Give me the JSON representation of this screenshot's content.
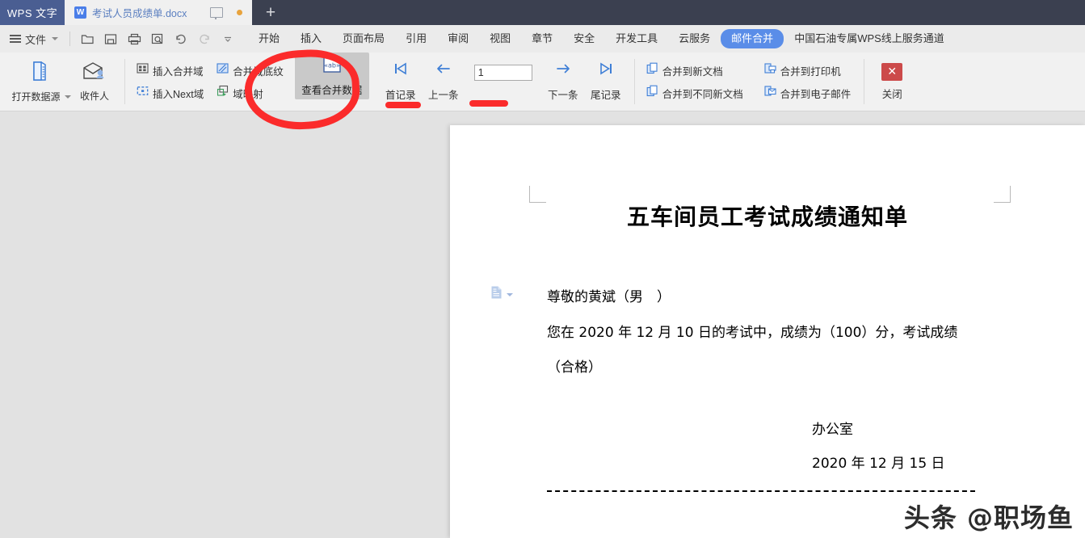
{
  "titlebar": {
    "app_name": "WPS 文字",
    "tab": {
      "title": "考试人员成绩单.docx",
      "file_icon": "word-doc-icon",
      "monitor_icon": "monitor-icon",
      "unsaved_dot": "unsaved-indicator"
    },
    "new_tab_label": "+"
  },
  "menubar": {
    "file_label": "文件",
    "quick_access": [
      {
        "name": "open-icon",
        "title": "打开"
      },
      {
        "name": "save-icon",
        "title": "保存"
      },
      {
        "name": "print-icon",
        "title": "打印"
      },
      {
        "name": "print-preview-icon",
        "title": "打印预览"
      },
      {
        "name": "undo-icon",
        "title": "撤销"
      },
      {
        "name": "redo-icon",
        "title": "恢复"
      },
      {
        "name": "chevron-down-icon",
        "title": "自定义快速访问工具栏"
      }
    ],
    "tabs": [
      {
        "label": "开始",
        "active": false
      },
      {
        "label": "插入",
        "active": false
      },
      {
        "label": "页面布局",
        "active": false
      },
      {
        "label": "引用",
        "active": false
      },
      {
        "label": "审阅",
        "active": false
      },
      {
        "label": "视图",
        "active": false
      },
      {
        "label": "章节",
        "active": false
      },
      {
        "label": "安全",
        "active": false
      },
      {
        "label": "开发工具",
        "active": false
      },
      {
        "label": "云服务",
        "active": false
      },
      {
        "label": "邮件合并",
        "active": true
      },
      {
        "label": "中国石油专属WPS线上服务通道",
        "active": false
      }
    ]
  },
  "ribbon": {
    "open_data_source": {
      "label": "打开数据源",
      "icon": "data-source-icon",
      "has_dropdown": true
    },
    "recipients": {
      "label": "收件人",
      "icon": "recipients-envelope-icon"
    },
    "fields": [
      {
        "label": "插入合并域",
        "icon": "insert-merge-field-icon"
      },
      {
        "label": "合并域底纹",
        "icon": "merge-field-shading-icon"
      },
      {
        "label": "插入Next域",
        "icon": "insert-next-field-icon"
      },
      {
        "label": "域映射",
        "icon": "field-mapping-icon"
      }
    ],
    "view_merged_data": {
      "label": "查看合并数据",
      "icon": "view-merge-data-ab-icon"
    },
    "nav": {
      "first": {
        "label": "首记录",
        "icon": "first-record-icon"
      },
      "prev": {
        "label": "上一条",
        "icon": "prev-record-arrow-icon"
      },
      "record_value": "1",
      "record_placeholder": "",
      "next": {
        "label": "下一条",
        "icon": "next-record-arrow-icon"
      },
      "last": {
        "label": "尾记录",
        "icon": "last-record-icon"
      }
    },
    "merge_actions": [
      {
        "label": "合并到新文档",
        "icon": "merge-to-new-doc-icon"
      },
      {
        "label": "合并到打印机",
        "icon": "merge-to-printer-icon"
      },
      {
        "label": "合并到不同新文档",
        "icon": "merge-to-different-docs-icon"
      },
      {
        "label": "合并到电子邮件",
        "icon": "merge-to-email-icon"
      }
    ],
    "close": {
      "label": "关闭",
      "icon": "close-x-icon"
    }
  },
  "document": {
    "title": "五车间员工考试成绩通知单",
    "field_icon": "merge-field-marker-icon",
    "greeting": "尊敬的黄斌（男　）",
    "body_line1": "您在 2020 年 12 月 10 日的考试中，成绩为（100）分，考试成绩",
    "body_line2": "（合格）",
    "office": "办公室",
    "date": "2020 年 12 月 15 日"
  },
  "watermark": {
    "text": "头条 @职场鱼"
  },
  "annotations": {
    "circle_target": "查看合并数据",
    "underline_targets": [
      "上一条",
      "下一条"
    ],
    "color": "#fb2b2b"
  }
}
